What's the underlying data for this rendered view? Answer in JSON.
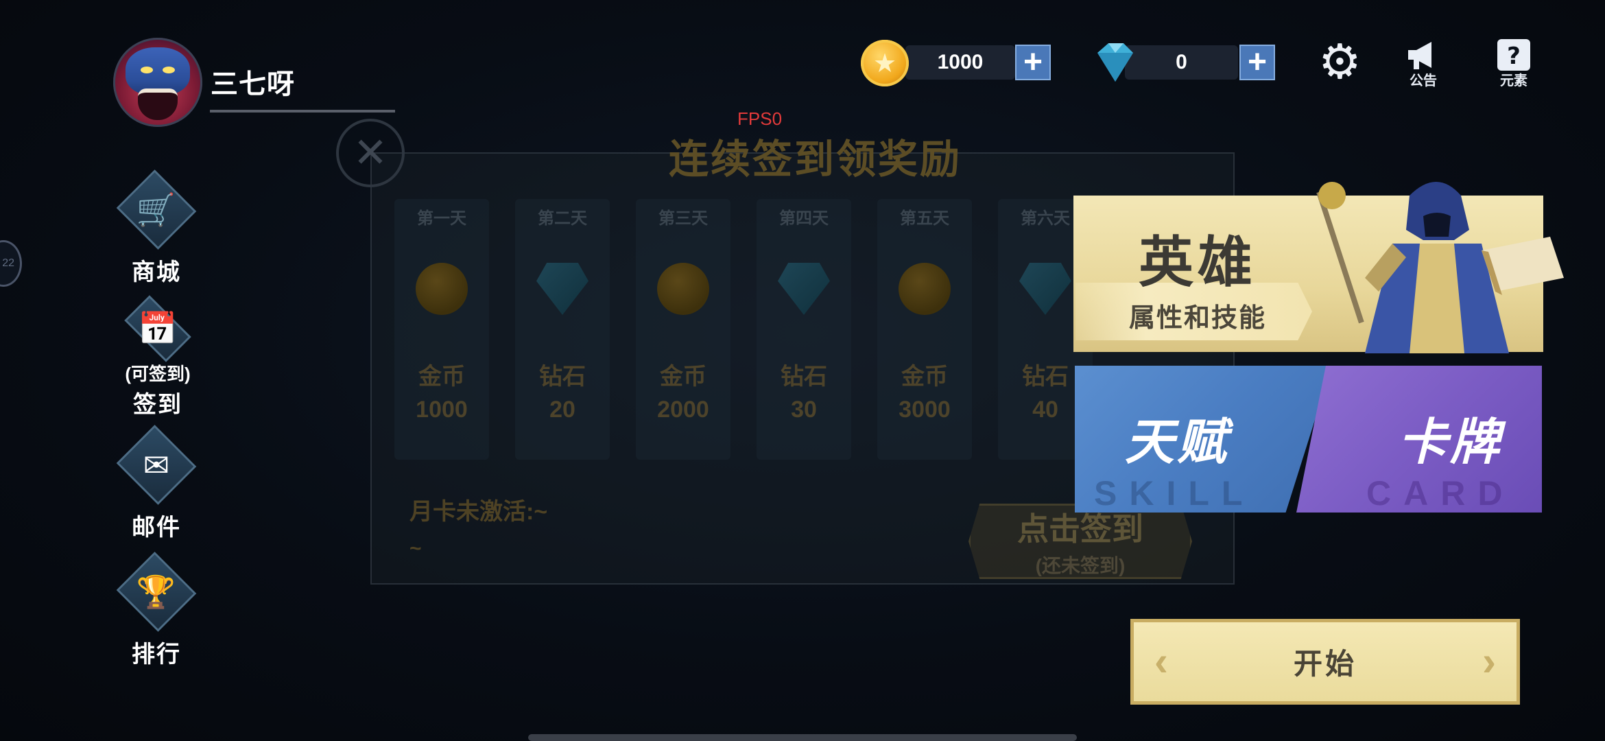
{
  "profile": {
    "name": "三七呀"
  },
  "currency": {
    "gold": "1000",
    "diamond": "0",
    "add_symbol": "+"
  },
  "top_icons": {
    "announcement": "公告",
    "elements": "元素"
  },
  "side_tab": {
    "label": "22"
  },
  "menu": {
    "shop": "商城",
    "signin_status": "(可签到)",
    "signin": "签到",
    "mail": "邮件",
    "ranking": "排行"
  },
  "fps": "FPS0",
  "signin_panel": {
    "title": "连续签到领奖励",
    "days": [
      {
        "label": "第一天",
        "reward": "金币",
        "amount": "1000",
        "icon": "coin-icon"
      },
      {
        "label": "第二天",
        "reward": "钻石",
        "amount": "20",
        "icon": "diamond-icon"
      },
      {
        "label": "第三天",
        "reward": "金币",
        "amount": "2000",
        "icon": "coin-icon"
      },
      {
        "label": "第四天",
        "reward": "钻石",
        "amount": "30",
        "icon": "diamond-icon"
      },
      {
        "label": "第五天",
        "reward": "金币",
        "amount": "3000",
        "icon": "coin-icon"
      },
      {
        "label": "第六天",
        "reward": "钻石",
        "amount": "40",
        "icon": "diamond-icon"
      }
    ],
    "monthly_card": "月卡未激活:~",
    "monthly_tilde": "~",
    "signin_button": "点击签到",
    "signin_button_sub": "(还未签到)"
  },
  "features": {
    "hero_title": "英雄",
    "hero_sub": "属性和技能",
    "talent_title": "天赋",
    "talent_ghost": "SKILL",
    "card_title": "卡牌",
    "card_ghost": "CARD"
  },
  "start_button": "开始",
  "colors": {
    "gold_accent": "#f1a81c",
    "diamond_accent": "#3fb0d8",
    "hero_card": "#eadb9c",
    "talent_card": "#4a7dc2",
    "card_card": "#7b5cc4",
    "fps_text": "#e23a3a"
  }
}
